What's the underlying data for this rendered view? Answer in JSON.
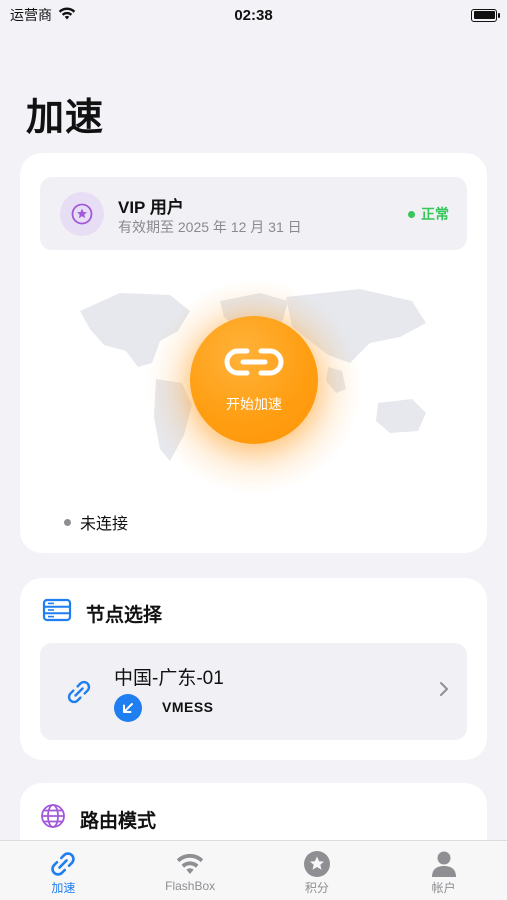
{
  "status_bar": {
    "carrier": "运营商",
    "time": "02:38"
  },
  "page": {
    "title": "加速"
  },
  "vip": {
    "title": "VIP 用户",
    "expiry": "有效期至 2025 年 12 月 31 日",
    "status": "正常"
  },
  "connect": {
    "label": "开始加速",
    "state": "未连接"
  },
  "nodes": {
    "header": "节点选择",
    "selected": {
      "name": "中国-广东-01",
      "protocol": "VMESS"
    }
  },
  "route": {
    "header": "路由模式"
  },
  "tabs": [
    {
      "label": "加速",
      "icon": "link-icon",
      "active": true
    },
    {
      "label": "FlashBox",
      "icon": "wifi-icon",
      "active": false
    },
    {
      "label": "积分",
      "icon": "star-icon",
      "active": false
    },
    {
      "label": "帐户",
      "icon": "person-icon",
      "active": false
    }
  ],
  "colors": {
    "accent": "#1f7ef0",
    "connect": "#ff9d10",
    "ok": "#34c759",
    "vip": "#a259d9"
  }
}
